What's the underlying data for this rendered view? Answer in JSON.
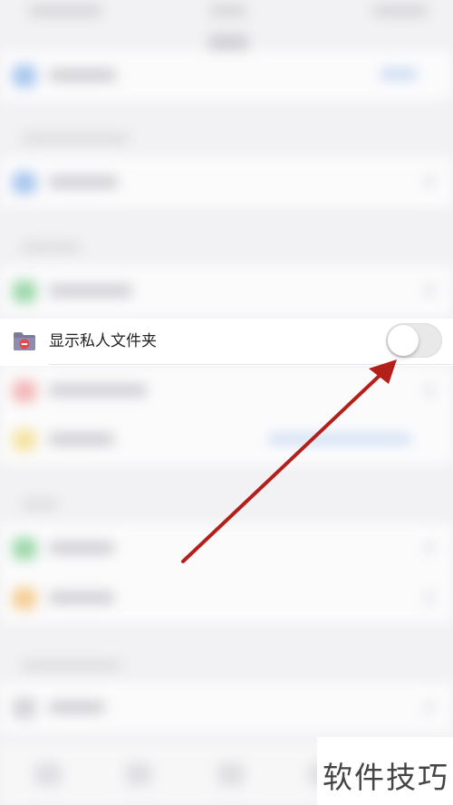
{
  "private_folder_row": {
    "label": "显示私人文件夹",
    "toggle_on": false,
    "icon": "private-folder-icon"
  },
  "annotation": {
    "arrow_color": "#b51f1a"
  },
  "watermark": {
    "text": "软件技巧"
  },
  "colors": {
    "background": "#f2f2f4",
    "row_background": "#ffffff",
    "toggle_off_track": "#e9e9ea"
  }
}
